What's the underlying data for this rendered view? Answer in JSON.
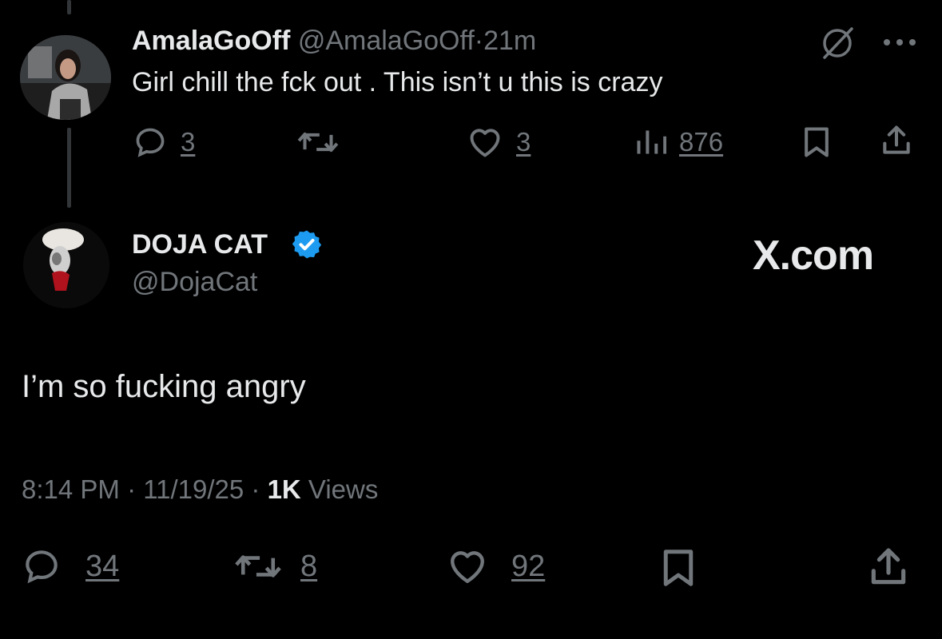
{
  "reply": {
    "display_name": "AmalaGoOff",
    "handle": "@AmalaGoOff",
    "separator": "·",
    "time": "21m",
    "text": "Girl chill the fck out . This isn’t u this is crazy",
    "avatar_icon": "user-avatar",
    "actions": {
      "reply_count": "3",
      "repost_count": "",
      "like_count": "3",
      "views_count": "876"
    }
  },
  "tweet": {
    "display_name": "DOJA CAT",
    "handle": "@DojaCat",
    "verified": true,
    "verified_color": "#1d9bf0",
    "watermark": "X.com",
    "text": "I’m so fucking angry",
    "timestamp": "8:14 PM · 11/19/25 · ",
    "views_number": "1K",
    "views_label": " Views",
    "actions": {
      "reply_count": "34",
      "repost_count": "8",
      "like_count": "92"
    }
  },
  "colors": {
    "background": "#000000",
    "text": "#e7e9ea",
    "muted": "#71767b",
    "thread_line": "#333639"
  }
}
